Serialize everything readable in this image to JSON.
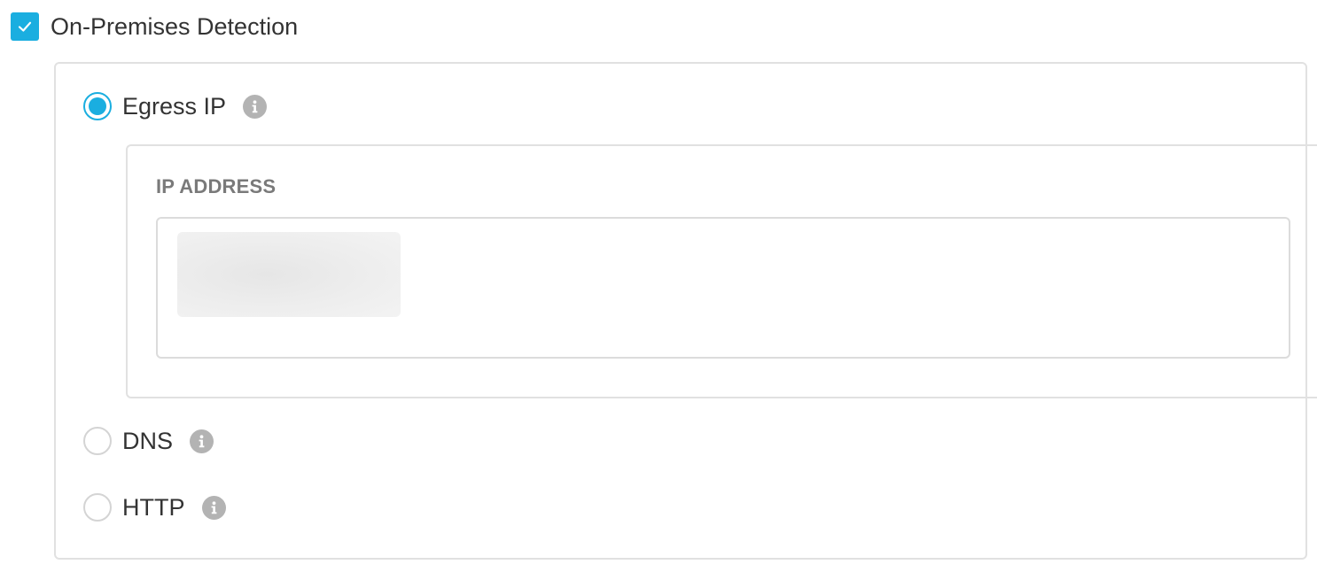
{
  "on_premises": {
    "label": "On-Premises Detection",
    "checked": true,
    "check_icon": "checkmark-icon"
  },
  "methods": [
    {
      "label": "Egress IP",
      "selected": true,
      "info_icon": "info-icon"
    },
    {
      "label": "DNS",
      "selected": false,
      "info_icon": "info-icon"
    },
    {
      "label": "HTTP",
      "selected": false,
      "info_icon": "info-icon"
    }
  ],
  "egress_ip": {
    "field_label": "IP ADDRESS",
    "value_redacted": true
  },
  "colors": {
    "accent": "#1aaee0",
    "border": "#e1e1e1",
    "label_gray": "#7a7a7a",
    "info_icon_bg": "#b3b3b3"
  }
}
